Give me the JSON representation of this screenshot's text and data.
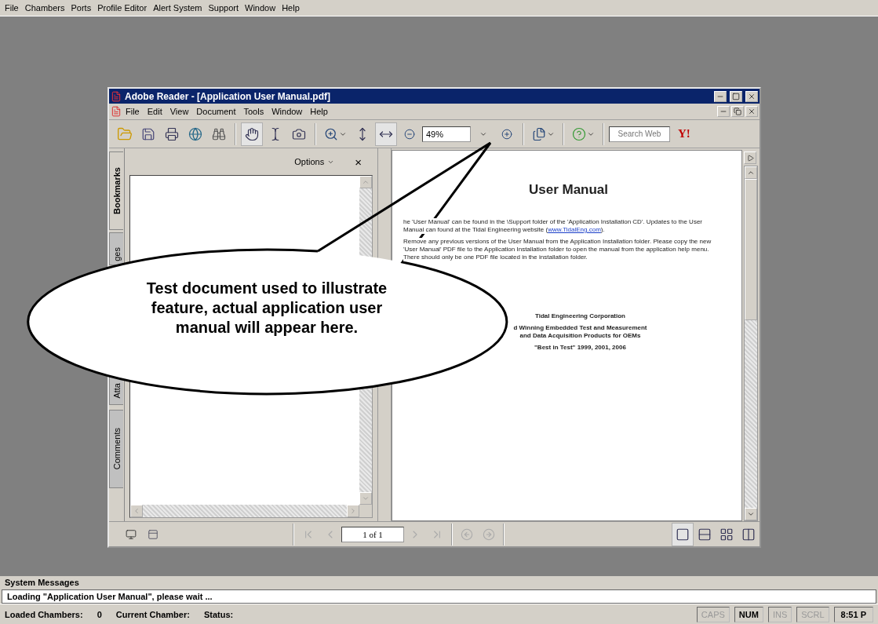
{
  "menu_bar": [
    {
      "label": "File"
    },
    {
      "label": "Chambers"
    },
    {
      "label": "Ports"
    },
    {
      "label": "Profile Editor"
    },
    {
      "label": "Alert System"
    },
    {
      "label": "Support"
    },
    {
      "label": "Window"
    },
    {
      "label": "Help"
    }
  ],
  "reader_window": {
    "title": "Adobe Reader - [Application User Manual.pdf]",
    "menu": [
      {
        "label": "File"
      },
      {
        "label": "Edit"
      },
      {
        "label": "View"
      },
      {
        "label": "Document"
      },
      {
        "label": "Tools"
      },
      {
        "label": "Window"
      },
      {
        "label": "Help"
      }
    ],
    "tools": [
      {
        "kind": "hand",
        "selected": true
      },
      {
        "kind": "select",
        "selected": false
      },
      {
        "kind": "snapshot",
        "selected": false
      }
    ],
    "fit": [
      {
        "kind": "fit-page",
        "selected": false
      },
      {
        "kind": "fit-width",
        "selected": true
      }
    ],
    "zoom": "49%",
    "search_placeholder": "Search Web",
    "logo": "Y!",
    "nav_tabs": [
      {
        "label": "Bookmarks",
        "selected": true
      },
      {
        "label": "ges",
        "selected": false
      },
      {
        "label": "Atta",
        "selected": false
      },
      {
        "label": "Comments",
        "selected": false
      }
    ],
    "panel": {
      "options": "Options",
      "close": "×"
    },
    "document": {
      "title": "User Manual",
      "paragraphs": [
        {
          "before": "he 'User Manual' can be found in the \\Support folder of the 'Application Installation CD'.  Updates to the User Manual can found at the Tidal Engineering website (",
          "link": "www.TidalEng.com",
          "after": ")."
        },
        {
          "before": "Remove any previous versions of the User Manual from the Application Installation folder.  Please copy the new 'User Manual' PDF file to the Application Installation folder to open the manual from the application help menu.  There should only be one PDF file located in the installation folder."
        }
      ],
      "footer": [
        "Tidal Engineering Corporation",
        "d Winning Embedded Test and Measurement",
        "and Data Acquisition Products for OEMs",
        "\"Best in Test\" 1999, 2001, 2006"
      ]
    },
    "page_field": "1 of 1",
    "view_modes": [
      {
        "kind": "single",
        "selected": true
      },
      {
        "kind": "continuous",
        "selected": false
      },
      {
        "kind": "facing-continuous",
        "selected": false
      },
      {
        "kind": "facing",
        "selected": false
      }
    ]
  },
  "callout": {
    "text": "Test document used to illustrate feature, actual application user manual will appear here."
  },
  "system_messages": {
    "title": "System Messages",
    "message": "Loading \"Application User Manual\", please wait ..."
  },
  "status_bar": {
    "fields": [
      {
        "label": "Loaded Chambers:",
        "value": "0"
      },
      {
        "label": "Current Chamber:"
      },
      {
        "label": "Status:"
      }
    ],
    "indicators": [
      {
        "label": "CAPS",
        "on": false
      },
      {
        "label": "NUM",
        "on": true
      },
      {
        "label": "INS",
        "on": false
      },
      {
        "label": "SCRL",
        "on": false
      }
    ],
    "clock": "8:51 P"
  }
}
